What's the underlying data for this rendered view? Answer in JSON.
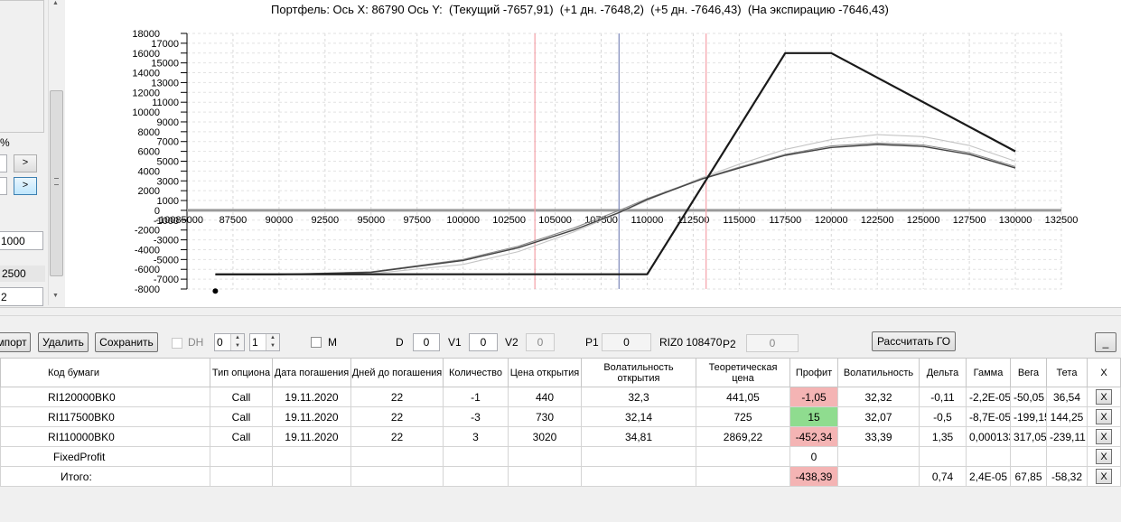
{
  "chart_title": "Портфель: Ось X: 86790 Ось Y:  (Текущий -7657,91)  (+1 дн. -7648,2)  (+5 дн. -7646,43)  (На экспирацию -7646,43)",
  "left_panel": {
    "percent_label": "%",
    "arrow_btn_1": ">",
    "arrow_btn_2": ">",
    "field_1000": "1000",
    "field_2500": "2500",
    "field_2": "2"
  },
  "chart_data": {
    "type": "line",
    "xlim": [
      85000,
      132500
    ],
    "ylim": [
      -8000,
      18000
    ],
    "x_ticks": [
      "-10085000",
      "87500",
      "90000",
      "92500",
      "95000",
      "97500",
      "100000",
      "102500",
      "105000",
      "107500",
      "110000",
      "112500",
      "115000",
      "117500",
      "120000",
      "122500",
      "125000",
      "127500",
      "130000",
      "132500"
    ],
    "y_ticks_left": [
      "18000",
      "16000",
      "14000",
      "12000",
      "10000",
      "8000",
      "6000",
      "4000",
      "2000",
      "0",
      "-2000",
      "-4000",
      "-6000",
      "-8000"
    ],
    "y_ticks_right": [
      "17000",
      "15000",
      "13000",
      "11000",
      "9000",
      "7000",
      "5000",
      "3000",
      "1000",
      "-1000",
      "-3000",
      "-5000",
      "-7000"
    ],
    "vertical_markers": [
      {
        "x": 103900,
        "color": "#f4a0a8"
      },
      {
        "x": 108470,
        "color": "#7b86b8"
      },
      {
        "x": 113200,
        "color": "#f4a0a8"
      }
    ],
    "series": [
      {
        "name": "На экспирацию",
        "color": "#1a1a1a",
        "width": 2.2,
        "points": [
          [
            86540,
            -6500
          ],
          [
            110000,
            -6500
          ],
          [
            117500,
            16000
          ],
          [
            120000,
            16000
          ],
          [
            130000,
            6000
          ]
        ]
      },
      {
        "name": "Текущий",
        "color": "#444444",
        "width": 1.4,
        "points": [
          [
            86540,
            -6550
          ],
          [
            90000,
            -6540
          ],
          [
            95000,
            -6300
          ],
          [
            100000,
            -5100
          ],
          [
            103000,
            -3800
          ],
          [
            106000,
            -2000
          ],
          [
            108500,
            -200
          ],
          [
            110000,
            1100
          ],
          [
            113000,
            3200
          ],
          [
            115000,
            4300
          ],
          [
            117500,
            5600
          ],
          [
            120000,
            6400
          ],
          [
            122500,
            6700
          ],
          [
            125000,
            6500
          ],
          [
            127500,
            5700
          ],
          [
            130000,
            4300
          ]
        ]
      },
      {
        "name": "+1 дн.",
        "color": "#8a8a8a",
        "width": 1.1,
        "points": [
          [
            86540,
            -6520
          ],
          [
            90000,
            -6500
          ],
          [
            95000,
            -6250
          ],
          [
            100000,
            -5000
          ],
          [
            103000,
            -3650
          ],
          [
            106000,
            -1800
          ],
          [
            108500,
            0
          ],
          [
            110000,
            1200
          ],
          [
            113000,
            3250
          ],
          [
            115000,
            4400
          ],
          [
            117500,
            5700
          ],
          [
            120000,
            6550
          ],
          [
            122500,
            6850
          ],
          [
            125000,
            6650
          ],
          [
            127500,
            5850
          ],
          [
            130000,
            4450
          ]
        ]
      },
      {
        "name": "+5 дн.",
        "color": "#c4c4c4",
        "width": 1.1,
        "points": [
          [
            86540,
            -6560
          ],
          [
            90000,
            -6560
          ],
          [
            95000,
            -6450
          ],
          [
            100000,
            -5500
          ],
          [
            103000,
            -4200
          ],
          [
            106000,
            -2200
          ],
          [
            108500,
            -250
          ],
          [
            110000,
            1000
          ],
          [
            113000,
            3350
          ],
          [
            115000,
            4700
          ],
          [
            117500,
            6200
          ],
          [
            120000,
            7200
          ],
          [
            122500,
            7700
          ],
          [
            125000,
            7500
          ],
          [
            127500,
            6600
          ],
          [
            130000,
            5000
          ]
        ]
      }
    ],
    "cursor_point": [
      86540,
      -7657.91
    ]
  },
  "toolbar": {
    "import_label": "мпорт",
    "delete_label": "Удалить",
    "save_label": "Сохранить",
    "dh_label": "DH",
    "spin1_value": "0",
    "spin2_value": "1",
    "m_label": "M",
    "d_label": "D",
    "d_value": "0",
    "v1_label": "V1",
    "v1_value": "0",
    "v2_label": "V2",
    "v2_value": "0",
    "p1_label": "P1",
    "p1_value": "0",
    "riz_label": "RIZ0 108470",
    "p2_label": "P2",
    "p2_value": "0",
    "calc_go_label": "Рассчитать ГО",
    "minimize_label": "_"
  },
  "table": {
    "headers": [
      "Код бумаги",
      "Тип опциона",
      "Дата погашения",
      "Дней до погашения",
      "Количество",
      "Цена открытия",
      "Волатильность открытия",
      "Теоретическая цена",
      "Профит",
      "Волатильность",
      "Дельта",
      "Гамма",
      "Вега",
      "Тета",
      "X"
    ],
    "rows": [
      [
        "RI120000BK0",
        "Call",
        "19.11.2020",
        "22",
        "-1",
        "440",
        "32,3",
        "441,05",
        "-1,05",
        "32,32",
        "-0,11",
        "-2,2E-05",
        "-50,05",
        "36,54",
        "X"
      ],
      [
        "RI117500BK0",
        "Call",
        "19.11.2020",
        "22",
        "-3",
        "730",
        "32,14",
        "725",
        "15",
        "32,07",
        "-0,5",
        "-8,7E-05",
        "-199,15",
        "144,25",
        "X"
      ],
      [
        "RI110000BK0",
        "Call",
        "19.11.2020",
        "22",
        "3",
        "3020",
        "34,81",
        "2869,22",
        "-452,34",
        "33,39",
        "1,35",
        "0,000133",
        "317,05",
        "-239,11",
        "X"
      ],
      [
        "FixedProfit",
        "",
        "",
        "",
        "",
        "",
        "",
        "",
        "0",
        "",
        "",
        "",
        "",
        "",
        "X"
      ],
      [
        "Итого:",
        "",
        "",
        "",
        "",
        "",
        "",
        "",
        "-438,39",
        "",
        "0,74",
        "2,4E-05",
        "67,85",
        "-58,32",
        "X"
      ]
    ],
    "profit_status": [
      "neg",
      "pos",
      "neg",
      "",
      "neg"
    ]
  }
}
